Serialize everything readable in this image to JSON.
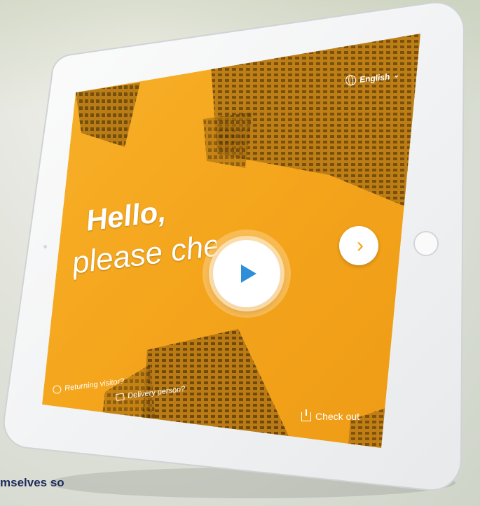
{
  "screen": {
    "greeting_line1": "Hello,",
    "greeting_line2": "please check",
    "language_label": "English",
    "returning_visitor_label": "Returning visitor?",
    "delivery_person_label": "Delivery person?",
    "check_out_label": "Check out"
  },
  "page_caption": "mselves so",
  "colors": {
    "screen_orange": "#f4a51c",
    "play_icon": "#2e8ed8",
    "caption_text": "#1e2a5a"
  },
  "icons": [
    "globe-icon",
    "chevron-down-icon",
    "chevron-right-icon",
    "play-icon",
    "returning-visitor-icon",
    "delivery-icon",
    "check-out-icon"
  ]
}
